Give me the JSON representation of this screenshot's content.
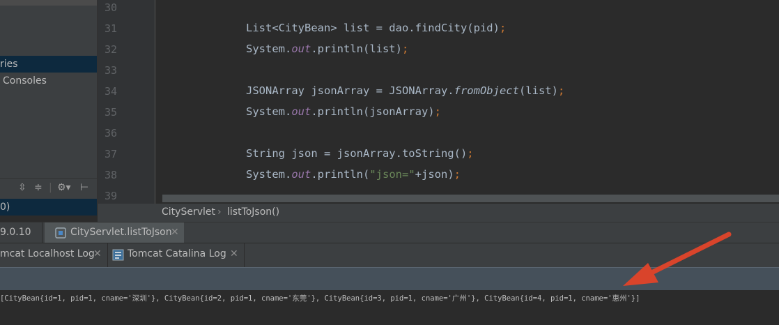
{
  "project_panel": {
    "items": [
      {
        "label": "ries"
      },
      {
        "label": "Consoles"
      }
    ],
    "bottom_item": "0)"
  },
  "editor": {
    "line_numbers": [
      "30",
      "31",
      "32",
      "33",
      "34",
      "35",
      "36",
      "37",
      "38",
      "39"
    ],
    "lines": {
      "l31": {
        "a": "List<CityBean> list = dao.findCity(pid)",
        "semi": ";"
      },
      "l32": {
        "a": "System.",
        "b": "out",
        "c": ".println(list)",
        "semi": ";"
      },
      "l34": {
        "a": "JSONArray jsonArray = JSONArray.",
        "b": "fromObject",
        "c": "(list)",
        "semi": ";"
      },
      "l35": {
        "a": "System.",
        "b": "out",
        "c": ".println(jsonArray)",
        "semi": ";"
      },
      "l37": {
        "a": "String json = jsonArray.toString()",
        "semi": ";"
      },
      "l38": {
        "a": "System.",
        "b": "out",
        "c": ".println(",
        "str": "\"json=\"",
        "d": "+json)",
        "semi": ";"
      }
    }
  },
  "breadcrumb": {
    "class_name": "CityServlet",
    "separator": "›",
    "method_name": "listToJson()"
  },
  "run_tabs": [
    {
      "label": "9.0.10"
    },
    {
      "label": "CityServlet.listToJson"
    }
  ],
  "log_tabs": [
    {
      "label": "mcat Localhost Log"
    },
    {
      "label": "Tomcat Catalina Log"
    }
  ],
  "console_output": "[CityBean{id=1, pid=1, cname='深圳'}, CityBean{id=2, pid=1, cname='东莞'}, CityBean{id=3, pid=1, cname='广州'}, CityBean{id=4, pid=1, cname='惠州'}]",
  "colors": {
    "arrow": "#d9442b",
    "keyword": "#cc7832",
    "static_field": "#9876aa",
    "string": "#6a8759"
  }
}
